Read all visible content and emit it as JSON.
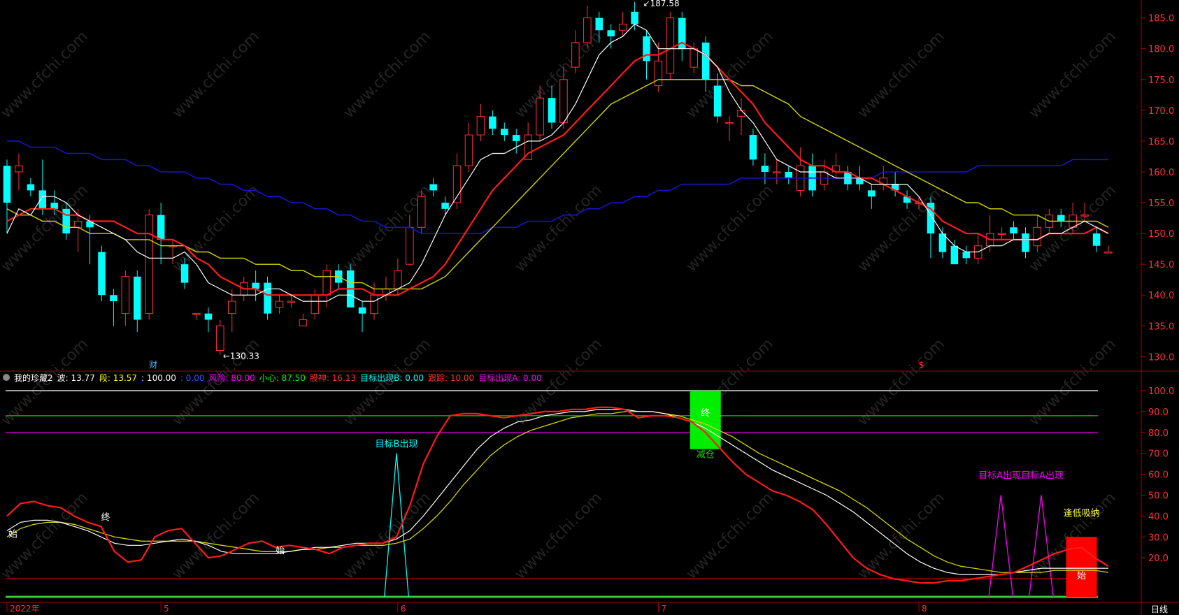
{
  "indicator_bar": {
    "name": "我的珍藏2",
    "items": [
      {
        "label": "波:",
        "value": "13.77",
        "color": "#ffffff"
      },
      {
        "label": "段:",
        "value": "13.57",
        "color": "#ffff00"
      },
      {
        "label": ":",
        "value": "100.00",
        "color": "#ffffff"
      },
      {
        "label": ":",
        "value": "0.00",
        "color": "#3355ff"
      },
      {
        "label": "风险:",
        "value": "80.00",
        "color": "#ff00ff"
      },
      {
        "label": "小心:",
        "value": "87.50",
        "color": "#00ff00"
      },
      {
        "label": "股神:",
        "value": "16.13",
        "color": "#ff3333"
      },
      {
        "label": "目标出现B:",
        "value": "0.00",
        "color": "#00ffff"
      },
      {
        "label": "跟踪:",
        "value": "10.00",
        "color": "#ff3333"
      },
      {
        "label": "目标出现A:",
        "value": "0.00",
        "color": "#ff00ff"
      }
    ]
  },
  "period_label": "日线",
  "watermark": "www.cfchi.com",
  "colors": {
    "up": "#ff3333",
    "down": "#00ffff",
    "axis": "#aa0000",
    "ma_white": "#ffffff",
    "ma_red": "#ff1a1a",
    "ma_yellow": "#d4d400",
    "ma_blue": "#1515c8",
    "axis_text": "#ff3333"
  },
  "chart_data": [
    {
      "type": "candlestick",
      "y_ticks": [
        "185.0",
        "180.0",
        "175.0",
        "170.0",
        "165.0",
        "160.0",
        "155.0",
        "150.0",
        "145.0",
        "140.0",
        "135.0",
        "130.0"
      ],
      "ylim": [
        128,
        187
      ],
      "annotations": {
        "high_label": "187.58",
        "low_label": "130.33",
        "marker_left": "财",
        "marker_right": "$"
      },
      "candles": [
        [
          161,
          155,
          162,
          150
        ],
        [
          160,
          161,
          163,
          157
        ],
        [
          158,
          157,
          159,
          156
        ],
        [
          157,
          154,
          162,
          153
        ],
        [
          155,
          154,
          157,
          153
        ],
        [
          154,
          150,
          155,
          149
        ],
        [
          151,
          152,
          154,
          147
        ],
        [
          152,
          151,
          153,
          145
        ],
        [
          147,
          140,
          148,
          139
        ],
        [
          140,
          139,
          141,
          135
        ],
        [
          137,
          143,
          144,
          135
        ],
        [
          143,
          136,
          144,
          134
        ],
        [
          137,
          153,
          154,
          136
        ],
        [
          153,
          149,
          155,
          145
        ],
        [
          148,
          148,
          149,
          145
        ],
        [
          145,
          142,
          146,
          141
        ],
        [
          137,
          137,
          137,
          136
        ],
        [
          137,
          136,
          138,
          134
        ],
        [
          131,
          135,
          136,
          130.33
        ],
        [
          137,
          139,
          141,
          134
        ],
        [
          140,
          142,
          143,
          139
        ],
        [
          142,
          141,
          144,
          139
        ],
        [
          142,
          137,
          143,
          136
        ],
        [
          138,
          139,
          140,
          137
        ],
        [
          139,
          139,
          140,
          138
        ],
        [
          135,
          136,
          137,
          135
        ],
        [
          137,
          140,
          141,
          136
        ],
        [
          140,
          144,
          145,
          138
        ],
        [
          144,
          142,
          145,
          141
        ],
        [
          144,
          138,
          145,
          138
        ],
        [
          138,
          137,
          139,
          134
        ],
        [
          137,
          140,
          142,
          136
        ],
        [
          140,
          141,
          143,
          139
        ],
        [
          141,
          144,
          146,
          140
        ],
        [
          145,
          151,
          153,
          145
        ],
        [
          151,
          156,
          157,
          150
        ],
        [
          158,
          157,
          159,
          156
        ],
        [
          155,
          154,
          156,
          153
        ],
        [
          155,
          161,
          163,
          154
        ],
        [
          161,
          166,
          168,
          160
        ],
        [
          166,
          169,
          171,
          165
        ],
        [
          169,
          167,
          170,
          166
        ],
        [
          167,
          166,
          168,
          165
        ],
        [
          166,
          165,
          167,
          163
        ],
        [
          162,
          166,
          168,
          162
        ],
        [
          166,
          172,
          174,
          165
        ],
        [
          172,
          168,
          174,
          167
        ],
        [
          168,
          175,
          177,
          167
        ],
        [
          177,
          181,
          183,
          176
        ],
        [
          181,
          185,
          187,
          180
        ],
        [
          185,
          183,
          186,
          181
        ],
        [
          183,
          182,
          184,
          180
        ],
        [
          183,
          184,
          186,
          182
        ],
        [
          186,
          184,
          187.58,
          183
        ],
        [
          182,
          178,
          183,
          175
        ],
        [
          174,
          178,
          181,
          173
        ],
        [
          176,
          185,
          186,
          175
        ],
        [
          185,
          180,
          186,
          178
        ],
        [
          177,
          180,
          181,
          176
        ],
        [
          181,
          175,
          182,
          173
        ],
        [
          174,
          169,
          176,
          168
        ],
        [
          168,
          168,
          169,
          165
        ],
        [
          169,
          170,
          172,
          166
        ],
        [
          166,
          162,
          167,
          161
        ],
        [
          161,
          160,
          163,
          158
        ],
        [
          160,
          160,
          162,
          158
        ],
        [
          160,
          159,
          161,
          158
        ],
        [
          157,
          161,
          164,
          156
        ],
        [
          161,
          157,
          163,
          156
        ],
        [
          158,
          160,
          162,
          157
        ],
        [
          160,
          161,
          163,
          159
        ],
        [
          160,
          158,
          161,
          157
        ],
        [
          159,
          158,
          161,
          157
        ],
        [
          157,
          156,
          158,
          154
        ],
        [
          158,
          159,
          161,
          157
        ],
        [
          158,
          157,
          160,
          156
        ],
        [
          156,
          155,
          157,
          154
        ],
        [
          155,
          155,
          156,
          154
        ],
        [
          155,
          150,
          156,
          146
        ],
        [
          150,
          147,
          151,
          146
        ],
        [
          148,
          145,
          149,
          145
        ],
        [
          147,
          146,
          148,
          145
        ],
        [
          146,
          148,
          150,
          145
        ],
        [
          148,
          150,
          153,
          147
        ],
        [
          150,
          150,
          151,
          149
        ],
        [
          151,
          150,
          152,
          149
        ],
        [
          150,
          147,
          151,
          146
        ],
        [
          148,
          151,
          153,
          147
        ],
        [
          151,
          153,
          154,
          150
        ],
        [
          153,
          152,
          154,
          151
        ],
        [
          151,
          153,
          155,
          150
        ],
        [
          153,
          153,
          155,
          152
        ],
        [
          150,
          148,
          151,
          147
        ],
        [
          147,
          147,
          148,
          147
        ]
      ],
      "ma_white": [
        150,
        154,
        153,
        156,
        156,
        155,
        153,
        152,
        151,
        150,
        149,
        147,
        146,
        146,
        146,
        147,
        145,
        142,
        141,
        140,
        140,
        140,
        141,
        141,
        140,
        139,
        139,
        139,
        140,
        140,
        139,
        139,
        140,
        141,
        142,
        145,
        149,
        153,
        156,
        159,
        162,
        163,
        163,
        164,
        165,
        165,
        166,
        168,
        171,
        175,
        179,
        181,
        182,
        184,
        183,
        180,
        180,
        180,
        180,
        179,
        177,
        173,
        170,
        168,
        165,
        162,
        161,
        160,
        160,
        160,
        159,
        159,
        159,
        158,
        158,
        158,
        158,
        156,
        153,
        150,
        148,
        147,
        147,
        148,
        148,
        149,
        149,
        149,
        150,
        150,
        151,
        152,
        151,
        150
      ],
      "ma_red": [
        152,
        153,
        154,
        154,
        154,
        153,
        153,
        152,
        152,
        152,
        151,
        150,
        150,
        149,
        149,
        148,
        146,
        145,
        143,
        142,
        141,
        141,
        140,
        140,
        140,
        140,
        140,
        140,
        141,
        141,
        141,
        140,
        140,
        140,
        141,
        142,
        143,
        145,
        148,
        151,
        154,
        157,
        159,
        161,
        163,
        164,
        165,
        166,
        168,
        170,
        172,
        174,
        176,
        178,
        179,
        179,
        180,
        181,
        180,
        179,
        177,
        175,
        173,
        171,
        168,
        166,
        164,
        162,
        161,
        161,
        160,
        160,
        159,
        159,
        158,
        157,
        156,
        155,
        154,
        152,
        151,
        150,
        150,
        149,
        149,
        149,
        149,
        149,
        150,
        150,
        150,
        150,
        151,
        150
      ],
      "ma_yellow": [
        154,
        153,
        153,
        152,
        152,
        151,
        151,
        150,
        150,
        150,
        149,
        149,
        149,
        148,
        148,
        148,
        147,
        147,
        146,
        146,
        146,
        145,
        145,
        145,
        144,
        144,
        143,
        143,
        143,
        142,
        142,
        141,
        141,
        141,
        141,
        141,
        142,
        143,
        145,
        147,
        149,
        151,
        153,
        155,
        157,
        159,
        161,
        163,
        165,
        167,
        169,
        171,
        172,
        173,
        174,
        175,
        175,
        175,
        175,
        175,
        175,
        175,
        174,
        174,
        173,
        172,
        171,
        169,
        168,
        167,
        166,
        165,
        164,
        163,
        162,
        161,
        160,
        159,
        158,
        157,
        156,
        155,
        155,
        154,
        154,
        153,
        153,
        153,
        152,
        152,
        152,
        152,
        152,
        151
      ],
      "ma_blue": [
        165,
        165,
        164,
        164,
        164,
        163,
        163,
        163,
        162,
        162,
        162,
        161,
        161,
        160,
        160,
        160,
        159,
        159,
        158,
        158,
        157,
        157,
        156,
        156,
        155,
        155,
        154,
        154,
        153,
        153,
        152,
        152,
        151,
        151,
        151,
        150,
        150,
        150,
        150,
        150,
        150,
        151,
        151,
        151,
        152,
        152,
        152,
        153,
        153,
        154,
        154,
        155,
        155,
        156,
        156,
        157,
        157,
        158,
        158,
        158,
        158,
        158,
        159,
        159,
        159,
        159,
        159,
        159,
        159,
        159,
        159,
        159,
        159,
        159,
        160,
        160,
        160,
        160,
        160,
        160,
        160,
        160,
        161,
        161,
        161,
        161,
        161,
        161,
        161,
        161,
        162,
        162,
        162,
        162
      ],
      "x_labels": [
        {
          "text": "2022年",
          "i": 0
        },
        {
          "text": "5",
          "i": 13
        },
        {
          "text": "6",
          "i": 33
        },
        {
          "text": "7",
          "i": 55
        },
        {
          "text": "8",
          "i": 77
        }
      ]
    },
    {
      "type": "line",
      "y_ticks": [
        "100.0",
        "90.0",
        "80.0",
        "70.0",
        "60.0",
        "50.0",
        "40.0",
        "30.0",
        "20.0"
      ],
      "ylim": [
        0,
        103
      ],
      "levels": [
        {
          "value": 100,
          "color": "#ffffff"
        },
        {
          "value": 88,
          "color": "#00cc00"
        },
        {
          "value": 80,
          "color": "#cc00cc"
        },
        {
          "value": 10,
          "color": "#cc0000"
        }
      ],
      "series_red": [
        40,
        46,
        47,
        45,
        44,
        40,
        37,
        35,
        23,
        18,
        19,
        30,
        33,
        34,
        27,
        20,
        21,
        24,
        27,
        28,
        25,
        26,
        25,
        24,
        22,
        25,
        26,
        27,
        27,
        30,
        45,
        65,
        78,
        88,
        89,
        89,
        88,
        87,
        88,
        89,
        90,
        90,
        91,
        91,
        92,
        92,
        91,
        87,
        88,
        88,
        87,
        85,
        80,
        73,
        66,
        60,
        56,
        52,
        50,
        47,
        43,
        36,
        28,
        20,
        15,
        12,
        10,
        9,
        8,
        8,
        9,
        9,
        10,
        11,
        12,
        13,
        16,
        19,
        22,
        24,
        25,
        20,
        16
      ],
      "series_white": [
        33,
        37,
        38,
        38,
        37,
        35,
        33,
        30,
        27,
        26,
        26,
        27,
        28,
        29,
        28,
        26,
        23,
        22,
        22,
        22,
        22,
        23,
        24,
        25,
        25,
        26,
        27,
        27,
        27,
        29,
        33,
        40,
        48,
        56,
        64,
        72,
        78,
        82,
        85,
        86,
        88,
        89,
        90,
        90,
        91,
        91,
        91,
        90,
        90,
        89,
        87,
        85,
        82,
        78,
        74,
        70,
        66,
        62,
        59,
        56,
        53,
        50,
        46,
        42,
        37,
        32,
        27,
        22,
        18,
        15,
        13,
        12,
        12,
        12,
        12,
        13,
        14,
        15,
        15,
        15,
        15,
        15,
        15
      ],
      "series_yellow": [
        30,
        34,
        36,
        37,
        37,
        36,
        34,
        32,
        30,
        29,
        28,
        28,
        28,
        28,
        28,
        27,
        26,
        25,
        24,
        23,
        23,
        23,
        24,
        24,
        25,
        25,
        26,
        26,
        26,
        27,
        29,
        34,
        40,
        47,
        55,
        62,
        69,
        74,
        78,
        81,
        83,
        85,
        87,
        88,
        89,
        89,
        90,
        90,
        90,
        89,
        88,
        86,
        84,
        81,
        78,
        74,
        70,
        67,
        64,
        61,
        58,
        55,
        52,
        48,
        44,
        39,
        34,
        29,
        25,
        21,
        18,
        16,
        15,
        14,
        13,
        13,
        13,
        13,
        14,
        14,
        14,
        14,
        13
      ],
      "spikes_cyan": [
        {
          "i": 29,
          "value": 70
        }
      ],
      "spikes_magenta": [
        {
          "i": 74,
          "value": 50
        },
        {
          "i": 77,
          "value": 50
        }
      ],
      "annotations": {
        "target_b": "目标B出现",
        "target_a": "目标A出现目标A出现",
        "reduce": "减仓",
        "buy_low": "逢低吸纳",
        "start_1": "始",
        "start_2": "始",
        "start_3": "始",
        "end_1": "终",
        "end_2": "终"
      }
    }
  ]
}
